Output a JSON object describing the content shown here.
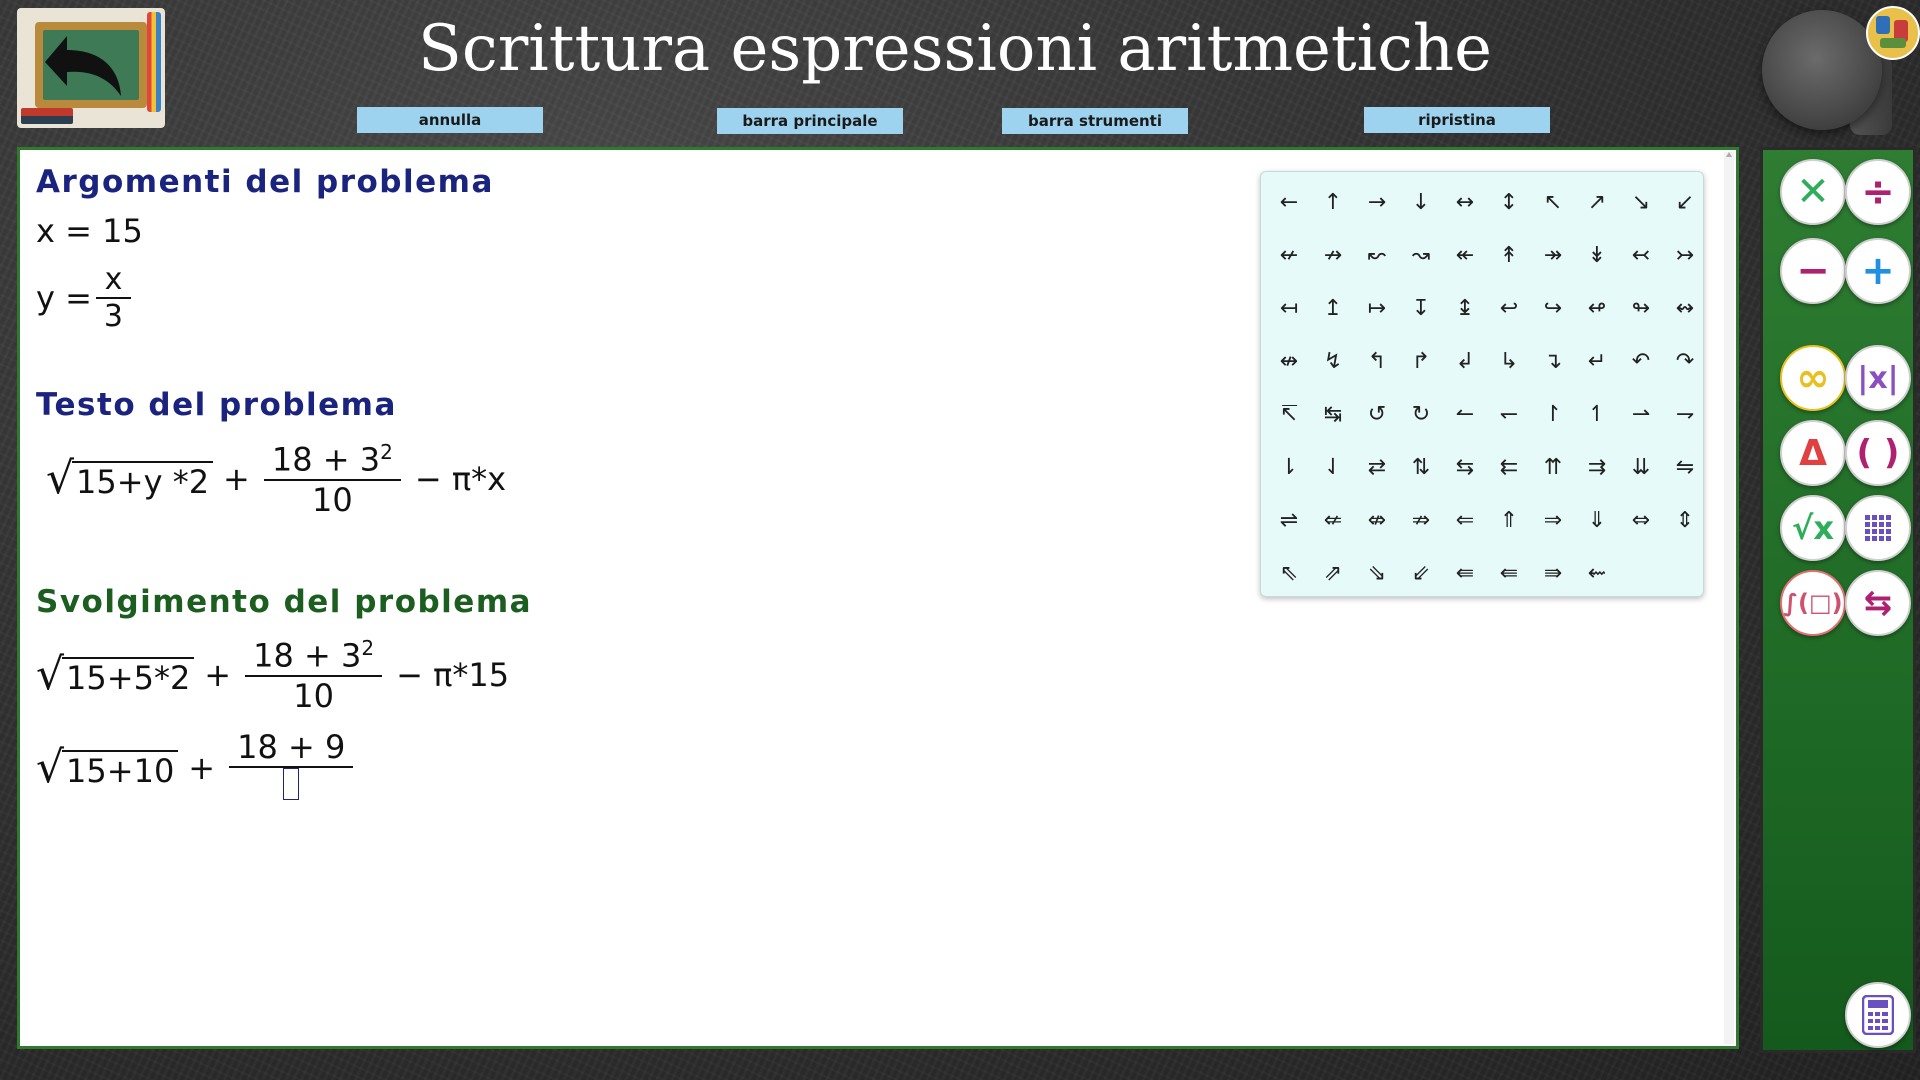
{
  "header": {
    "title": "Scrittura espressioni aritmetiche",
    "buttons": {
      "annulla": "annulla",
      "barra_principale": "barra principale",
      "barra_strumenti": "barra strumenti",
      "ripristina": "ripristina"
    }
  },
  "work": {
    "arguments": {
      "heading": "Argomenti del problema",
      "x_line": "x = 15",
      "y_lhs": "y =",
      "y_num": "x",
      "y_den": "3"
    },
    "text": {
      "heading": "Testo del problema",
      "root": "15+y *2",
      "plus": "+",
      "frac_num": "18 + 3",
      "frac_exp": "2",
      "frac_den": "10",
      "tail": "− π*x"
    },
    "solution": {
      "heading": "Svolgimento del problema",
      "step1": {
        "root": "15+5*2",
        "plus": "+",
        "frac_num": "18 + 3",
        "frac_exp": "2",
        "frac_den": "10",
        "tail": "− π*15"
      },
      "step2": {
        "root": "15+10",
        "plus": "+",
        "frac_num": "18 + 9"
      }
    }
  },
  "palette": {
    "symbols": [
      "←",
      "↑",
      "→",
      "↓",
      "↔",
      "↕",
      "↖",
      "↗",
      "↘",
      "↙",
      "↚",
      "↛",
      "↜",
      "↝",
      "↞",
      "↟",
      "↠",
      "↡",
      "↢",
      "↣",
      "↤",
      "↥",
      "↦",
      "↧",
      "↨",
      "↩",
      "↪",
      "↫",
      "↬",
      "↭",
      "↮",
      "↯",
      "↰",
      "↱",
      "↲",
      "↳",
      "↴",
      "↵",
      "↶",
      "↷",
      "↸",
      "↹",
      "↺",
      "↻",
      "↼",
      "↽",
      "↾",
      "↿",
      "⇀",
      "⇁",
      "⇂",
      "⇃",
      "⇄",
      "⇅",
      "⇆",
      "⇇",
      "⇈",
      "⇉",
      "⇊",
      "⇋",
      "⇌",
      "⇍",
      "⇎",
      "⇏",
      "⇐",
      "⇑",
      "⇒",
      "⇓",
      "⇔",
      "⇕",
      "⇖",
      "⇗",
      "⇘",
      "⇙",
      "⇚",
      "⇚",
      "⇛",
      "⇜"
    ]
  },
  "sidebar": {
    "multiply": "✕",
    "divide": "÷",
    "minus": "−",
    "plus": "+",
    "infinity": "∞",
    "absolute": "|x|",
    "delta": "Δ",
    "parens": "( )",
    "sqrt": "√x",
    "grid_icon": "grid-icon",
    "integral": "∫(□)",
    "tab_arrows": "⇆",
    "calculator_icon": "calculator-icon"
  },
  "colors": {
    "accent_green": "#2e7d32",
    "heading_blue": "#1a237e",
    "heading_green": "#1b5e20",
    "button_blue": "#9ed3ef",
    "palette_bg": "#e6fafa"
  }
}
